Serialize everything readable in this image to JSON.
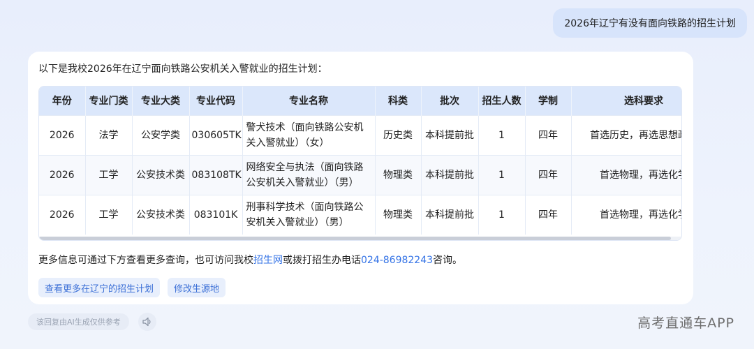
{
  "user_message": "2026年辽宁有没有面向铁路的招生计划",
  "answer": {
    "intro": "以下是我校2026年在辽宁面向铁路公安机关入警就业的招生计划：",
    "table": {
      "headers": [
        "年份",
        "专业门类",
        "专业大类",
        "专业代码",
        "专业名称",
        "科类",
        "批次",
        "招生人数",
        "学制",
        "选科要求"
      ],
      "rows": [
        {
          "year": "2026",
          "category": "法学",
          "major_class": "公安学类",
          "code": "030605TK",
          "name_line1": "警犬技术（面向铁路公安机",
          "name_line2": "关入警就业）（女）",
          "subject_type": "历史类",
          "batch": "本科提前批",
          "count": "1",
          "duration": "四年",
          "requirement": "首选历史，再选思想政治"
        },
        {
          "year": "2026",
          "category": "工学",
          "major_class": "公安技术类",
          "code": "083108TK",
          "name_line1": "网络安全与执法（面向铁路",
          "name_line2": "公安机关入警就业）（男）",
          "subject_type": "物理类",
          "batch": "本科提前批",
          "count": "1",
          "duration": "四年",
          "requirement": "首选物理，再选化学"
        },
        {
          "year": "2026",
          "category": "工学",
          "major_class": "公安技术类",
          "code": "083101K",
          "name_line1": "刑事科学技术（面向铁路公",
          "name_line2": "安机关入警就业）（男）",
          "subject_type": "物理类",
          "batch": "本科提前批",
          "count": "1",
          "duration": "四年",
          "requirement": "首选物理，再选化学"
        }
      ]
    },
    "more_info": {
      "prefix": "更多信息可通过下方查看更多查询，也可访问我校",
      "link_text": "招生网",
      "middle": "或拨打招生办电话",
      "phone": "024-86982243",
      "suffix": "咨询。"
    },
    "chips": [
      "查看更多在辽宁的招生计划",
      "修改生源地"
    ]
  },
  "disclaimer": "该回复由AI生成仅供参考",
  "speaker_icon": "speaker-icon",
  "watermark": "高考直通车APP"
}
